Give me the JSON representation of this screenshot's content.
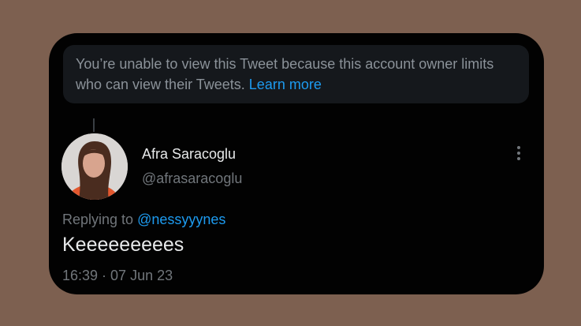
{
  "notice": {
    "text": "You’re unable to view this Tweet because this account owner limits who can view their Tweets.",
    "link_label": "Learn more"
  },
  "author": {
    "name": "Afra Saracoglu",
    "handle": "@afrasaracoglu"
  },
  "reply": {
    "prefix": "Replying to",
    "mention": "@nessyyynes"
  },
  "tweet": {
    "text": "Keeeeeeeees",
    "timestamp": "16:39 · 07 Jun 23"
  },
  "icons": {
    "more": "more-vertical-icon",
    "avatar": "profile-photo"
  },
  "colors": {
    "background": "#7d6050",
    "card": "#020202",
    "link": "#1d9bf0",
    "muted": "#71767b",
    "text": "#e7e9ea"
  }
}
